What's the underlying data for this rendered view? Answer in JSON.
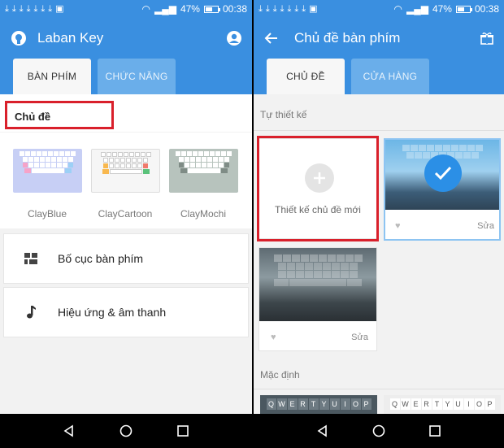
{
  "status": {
    "battery": "47%",
    "time": "00:38",
    "battery_level": 0.47
  },
  "left": {
    "app_title": "Laban Key",
    "tabs": [
      "BÀN PHÍM",
      "CHỨC NĂNG"
    ],
    "section_theme": "Chủ đề",
    "themes": [
      {
        "name": "ClayBlue",
        "bg": "#c7cff5",
        "key": "#ffffff"
      },
      {
        "name": "ClayCartoon",
        "bg": "#f6f6f6",
        "key": "#ffffff"
      },
      {
        "name": "ClayMochi",
        "bg": "#b7c3bd",
        "key": "#ffffff"
      }
    ],
    "menu": [
      "Bố cục bàn phím",
      "Hiệu ứng & âm thanh"
    ],
    "icons": {
      "layout": "keyboard-layout-icon",
      "effects": "music-note-icon"
    }
  },
  "right": {
    "title": "Chủ đề bàn phím",
    "tabs": [
      "CHỦ ĐỀ",
      "CỬA HÀNG"
    ],
    "custom_label": "Tự thiết kế",
    "create_label": "Thiết kế chủ đề mới",
    "edit_label": "Sửa",
    "default_label": "Mặc định",
    "kb_keys": [
      "Q",
      "W",
      "E",
      "R",
      "T",
      "Y",
      "U",
      "I",
      "O",
      "P"
    ]
  },
  "colors": {
    "primary": "#3a8fe0",
    "highlight": "#d9202b",
    "check": "#2b8fe6"
  }
}
